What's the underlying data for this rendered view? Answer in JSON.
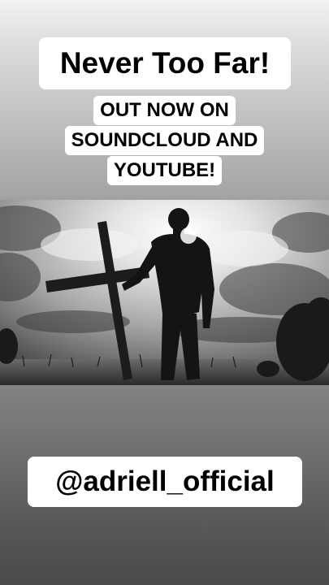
{
  "story": {
    "title": "Never Too Far!",
    "subtitle_lines": [
      "OUT NOW ON",
      "SOUNDCLOUD AND",
      "YOUTUBE!"
    ],
    "handle": "@adriell_official"
  },
  "photo": {
    "description_icon": "man-with-cross-photo"
  },
  "colors": {
    "pill_bg": "#ffffff",
    "text": "#000000",
    "top_gradient_start": "#f2f2f2",
    "bottom_gradient_end": "#4a4a4a"
  }
}
